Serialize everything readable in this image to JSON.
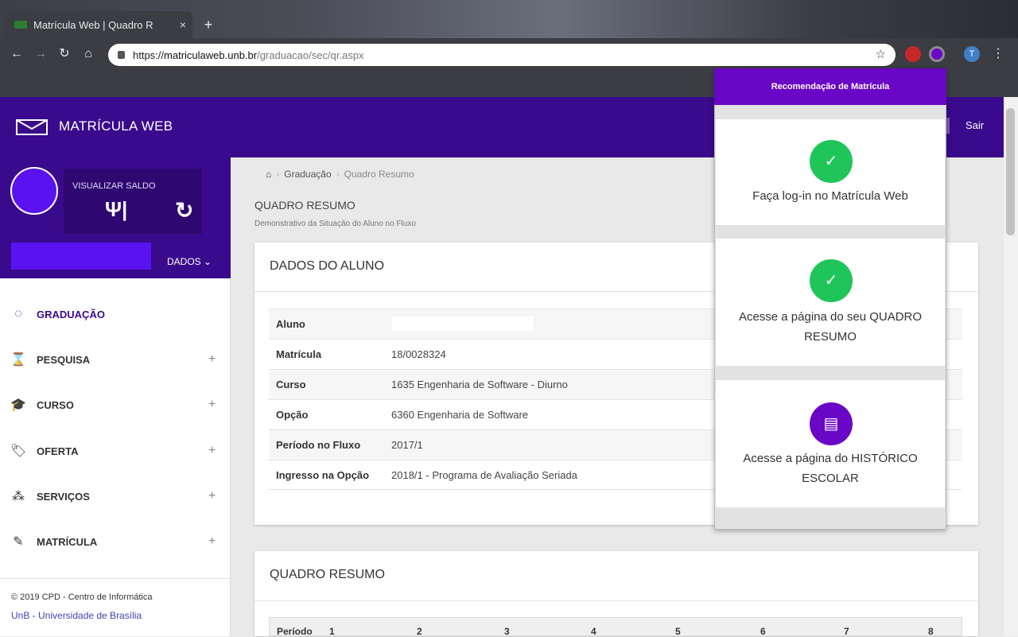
{
  "browser": {
    "tab_title": "Matrícula Web | Quadro R",
    "tab_close": "×",
    "new_tab": "+",
    "url_scheme": "https://",
    "url_host": "matriculaweb.unb.br",
    "url_path": "/graduacao/sec/qr.aspx"
  },
  "header": {
    "app_title": "MATRÍCULA WEB",
    "logout": "Sair"
  },
  "profile": {
    "saldo_label": "VISUALIZAR SALDO",
    "dados_label": "DADOS"
  },
  "menu": {
    "items": [
      {
        "label": "GRADUAÇÃO",
        "icon": "circle-notch-icon",
        "glyph": "◌"
      },
      {
        "label": "PESQUISA",
        "icon": "hourglass-icon",
        "glyph": "⌛"
      },
      {
        "label": "CURSO",
        "icon": "graduation-cap-icon",
        "glyph": "🎓"
      },
      {
        "label": "OFERTA",
        "icon": "tag-icon",
        "glyph": "🏷"
      },
      {
        "label": "SERVIÇOS",
        "icon": "services-icon",
        "glyph": "⁂"
      },
      {
        "label": "MATRÍCULA",
        "icon": "pencil-icon",
        "glyph": "✎"
      }
    ],
    "expand": "+"
  },
  "footer": {
    "line1": "© 2019 CPD - Centro de Informática",
    "line2": "UnB - Universidade de Brasília"
  },
  "breadcrumb": {
    "item1": "Graduação",
    "item2": "Quadro Resumo"
  },
  "page": {
    "title": "QUADRO RESUMO",
    "subtitle": "Demonstrativo da Situação do Aluno no Fluxo"
  },
  "dados_aluno": {
    "title": "DADOS DO ALUNO",
    "rows": [
      {
        "key": "Aluno",
        "value": ""
      },
      {
        "key": "Matrícula",
        "value": "18/0028324"
      },
      {
        "key": "Curso",
        "value": "1635 Engenharia de Software - Diurno"
      },
      {
        "key": "Opção",
        "value": "6360 Engenharia de Software"
      },
      {
        "key": "Período no Fluxo",
        "value": "2017/1"
      },
      {
        "key": "Ingresso na Opção",
        "value": "2018/1 - Programa de Avaliação Seriada"
      }
    ]
  },
  "quadro_resumo": {
    "title": "QUADRO RESUMO",
    "headers": [
      "Período",
      "1",
      "2",
      "3",
      "4",
      "5",
      "6",
      "7",
      "8"
    ]
  },
  "popup": {
    "title": "Recomendação de Matrícula",
    "steps": [
      {
        "text": "Faça log-in no Matrícula Web",
        "status": "done",
        "color": "#20c55a",
        "glyph": "✓"
      },
      {
        "text": "Acesse a página do seu QUADRO RESUMO",
        "status": "done",
        "color": "#20c55a",
        "glyph": "✓"
      },
      {
        "text": "Acesse a página do HISTÓRICO ESCOLAR",
        "status": "pending",
        "color": "#6a06c5",
        "glyph": "▤"
      }
    ]
  },
  "colors": {
    "brand": "#3a0a8c",
    "accent": "#5a12f0",
    "popup_purple": "#6a06c5",
    "success": "#20c55a"
  }
}
